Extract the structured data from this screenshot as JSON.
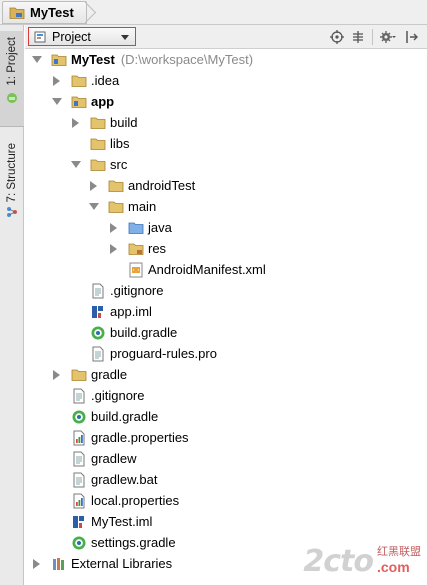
{
  "title": {
    "text": "MyTest"
  },
  "side_tabs": {
    "project": "1: Project",
    "structure": "7: Structure"
  },
  "toolbar": {
    "view_selector": "Project",
    "buttons": [
      "locate-icon",
      "collapse-all-icon",
      "gear-icon",
      "pin-icon"
    ]
  },
  "tree": [
    {
      "label": "MyTest",
      "hint": "(D:\\workspace\\MyTest)",
      "icon": "module-folder-icon",
      "expanded": true,
      "bold": true
    },
    {
      "label": ".idea",
      "icon": "folder-icon",
      "expanded": false
    },
    {
      "label": "app",
      "icon": "module-folder-icon",
      "expanded": true,
      "bold": true
    },
    {
      "label": "build",
      "icon": "folder-icon",
      "expanded": false
    },
    {
      "label": "libs",
      "icon": "folder-icon"
    },
    {
      "label": "src",
      "icon": "folder-icon",
      "expanded": true
    },
    {
      "label": "androidTest",
      "icon": "folder-icon",
      "expanded": false
    },
    {
      "label": "main",
      "icon": "folder-icon",
      "expanded": true
    },
    {
      "label": "java",
      "icon": "source-folder-icon",
      "expanded": false
    },
    {
      "label": "res",
      "icon": "resource-folder-icon",
      "expanded": false
    },
    {
      "label": "AndroidManifest.xml",
      "icon": "xml-file-icon"
    },
    {
      "label": ".gitignore",
      "icon": "text-file-icon"
    },
    {
      "label": "app.iml",
      "icon": "iml-file-icon"
    },
    {
      "label": "build.gradle",
      "icon": "gradle-file-icon"
    },
    {
      "label": "proguard-rules.pro",
      "icon": "text-file-icon"
    },
    {
      "label": "gradle",
      "icon": "folder-icon",
      "expanded": false
    },
    {
      "label": ".gitignore",
      "icon": "text-file-icon"
    },
    {
      "label": "build.gradle",
      "icon": "gradle-file-icon"
    },
    {
      "label": "gradle.properties",
      "icon": "properties-file-icon"
    },
    {
      "label": "gradlew",
      "icon": "text-file-icon"
    },
    {
      "label": "gradlew.bat",
      "icon": "text-file-icon"
    },
    {
      "label": "local.properties",
      "icon": "properties-file-icon"
    },
    {
      "label": "MyTest.iml",
      "icon": "iml-file-icon"
    },
    {
      "label": "settings.gradle",
      "icon": "gradle-file-icon"
    },
    {
      "label": "External Libraries",
      "icon": "libraries-icon",
      "expanded": false
    }
  ],
  "watermark": {
    "main": "2cto",
    "cn": "红黑联盟",
    "dot": ".com"
  },
  "colors": {
    "highlight_border": "#e03a3a",
    "folder": "#c9a24a",
    "source_folder": "#4a90d9",
    "gradle": "#3bb54a"
  }
}
